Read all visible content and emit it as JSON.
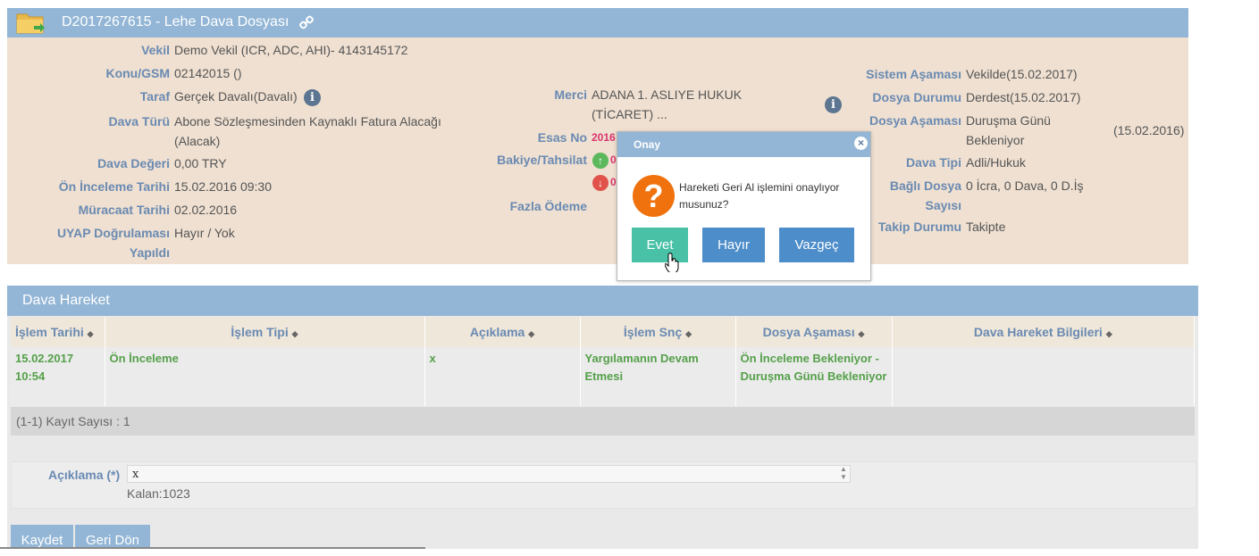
{
  "header": {
    "title": "D2017267615 - Lehe Dava Dosyası",
    "icons": [
      "folder-icon",
      "link-icon"
    ]
  },
  "info_left": [
    {
      "label": "Vekil",
      "value": "Demo Vekil  (ICR, ADC, AHI)- 4143145172"
    },
    {
      "label": "Konu/GSM",
      "value": "02142015 ()"
    },
    {
      "label": "Taraf",
      "value": "Gerçek Davalı(Davalı)"
    },
    {
      "label": "Dava Türü",
      "value": "Abone Sözleşmesinden Kaynaklı Fatura Alacağı (Alacak)"
    },
    {
      "label": "Dava Değeri",
      "value": "0,00 TRY"
    },
    {
      "label": "Ön İnceleme Tarihi",
      "value": "15.02.2016 09:30"
    },
    {
      "label": "Müracaat Tarihi",
      "value": "02.02.2016"
    },
    {
      "label": "UYAP Doğrulaması Yapıldı",
      "value": "Hayır / Yok"
    }
  ],
  "info_mid": {
    "merci_label": "Merci",
    "merci_value": "ADANA 1. ASLIYE HUKUK (TİCARET) ...",
    "esas_label": "Esas No",
    "esas_value": "2016",
    "bakiye_label": "Bakiye/Tahsilat",
    "bakiye_up": "0",
    "bakiye_down": "0",
    "fazla_label": "Fazla Ödeme"
  },
  "info_right": [
    {
      "label": "Sistem Aşaması",
      "value": "Vekilde(15.02.2017)"
    },
    {
      "label": "Dosya Durumu",
      "value": "Derdest(15.02.2017)"
    },
    {
      "label": "Dosya Aşaması",
      "value": "Duruşma Günü Bekleniyor"
    },
    {
      "label": "Dava Tipi",
      "value": "Adli/Hukuk"
    },
    {
      "label": "Bağlı Dosya Sayısı",
      "value": "0 İcra, 0 Dava, 0 D.İş"
    },
    {
      "label": "Takip Durumu",
      "value": "Takipte"
    }
  ],
  "dosya_asamasi_date": "(15.02.2016)",
  "dava_hareket": {
    "title": "Dava Hareket",
    "columns": [
      "İşlem Tarihi",
      "İşlem Tipi",
      "Açıklama",
      "İşlem Snç",
      "Dosya Aşaması",
      "Dava Hareket Bilgileri"
    ],
    "sort_glyph": "◆",
    "rows": [
      [
        "15.02.2017 10:54",
        "Ön İnceleme",
        "x",
        "Yargılamanın Devam Etmesi",
        "Ön İnceleme Bekleniyor - Duruşma Günü Bekleniyor",
        ""
      ]
    ],
    "record_count": "(1-1) Kayıt Sayısı : 1"
  },
  "form": {
    "aciklama_label": "Açıklama (*)",
    "aciklama_value": "x",
    "kalan": "Kalan:1023",
    "save_label": "Kaydet",
    "back_label": "Geri Dön"
  },
  "modal": {
    "title": "Onay",
    "close_glyph": "×",
    "question_glyph": "?",
    "message": "Hareketi Geri Al işlemini onaylıyor musunuz?",
    "yes": "Evet",
    "no": "Hayır",
    "cancel": "Vazgeç",
    "yes_color": "#48c1a7",
    "btn_color": "#4d8dc9"
  },
  "colors": {
    "header": "#93b6d6",
    "info_bg": "#efe0d1",
    "label": "#6a8ab2",
    "grid_text": "#55a04a"
  }
}
